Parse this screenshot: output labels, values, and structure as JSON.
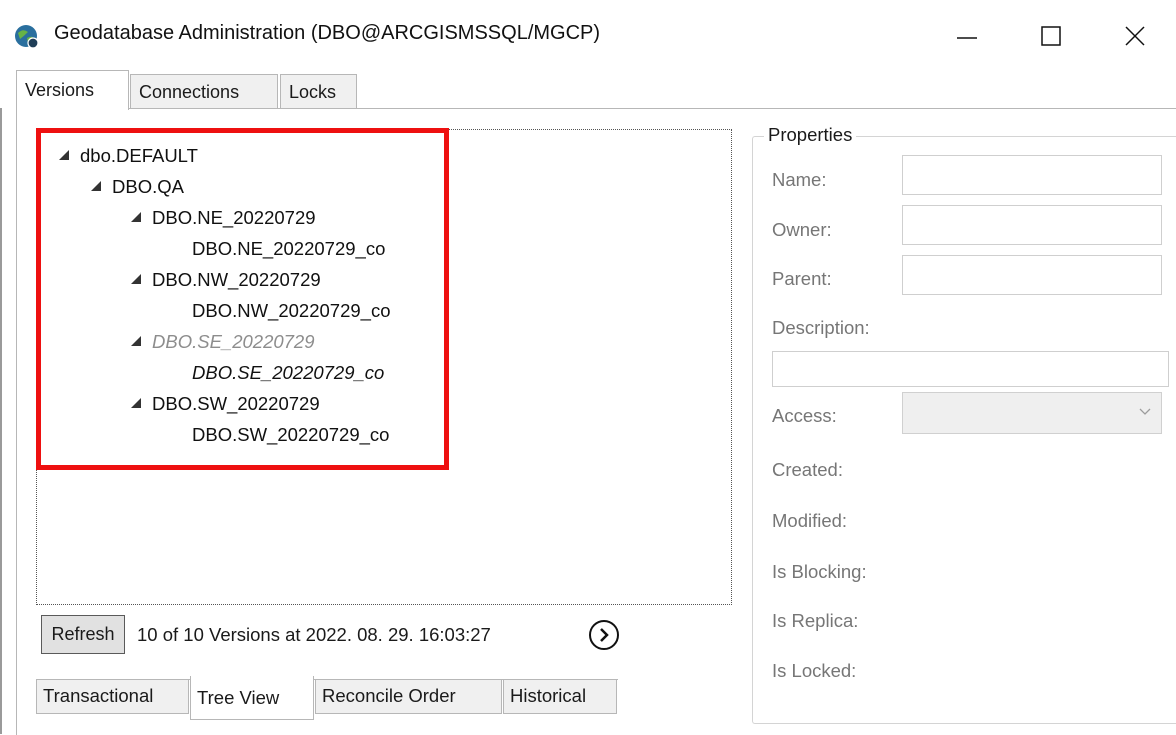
{
  "window": {
    "title": "Geodatabase Administration (DBO@ARCGISMSSQL/MGCP)",
    "icon": "globe-app-icon",
    "controls": [
      "minimize-icon",
      "maximize-icon",
      "close-icon"
    ]
  },
  "top_tabs": [
    {
      "label": "Versions",
      "active": true
    },
    {
      "label": "Connections",
      "active": false
    },
    {
      "label": "Locks",
      "active": false
    }
  ],
  "tree": {
    "nodes": [
      {
        "label": "dbo.DEFAULT",
        "expandable": true,
        "style": "normal"
      },
      {
        "label": "DBO.QA",
        "expandable": true,
        "style": "normal"
      },
      {
        "label": "DBO.NE_20220729",
        "expandable": true,
        "style": "normal"
      },
      {
        "label": "DBO.NE_20220729_co",
        "expandable": false,
        "style": "normal"
      },
      {
        "label": "DBO.NW_20220729",
        "expandable": true,
        "style": "normal"
      },
      {
        "label": "DBO.NW_20220729_co",
        "expandable": false,
        "style": "normal"
      },
      {
        "label": "DBO.SE_20220729",
        "expandable": true,
        "style": "dim-italic"
      },
      {
        "label": "DBO.SE_20220729_co",
        "expandable": false,
        "style": "italic"
      },
      {
        "label": "DBO.SW_20220729",
        "expandable": true,
        "style": "normal"
      },
      {
        "label": "DBO.SW_20220729_co",
        "expandable": false,
        "style": "normal"
      }
    ]
  },
  "footer": {
    "refresh_label": "Refresh",
    "status": "10 of 10 Versions at 2022. 08. 29. 16:03:27",
    "next_icon": "chevron-right-circle-icon"
  },
  "bottom_tabs": [
    {
      "label": "Transactional",
      "active": false
    },
    {
      "label": "Tree View",
      "active": true
    },
    {
      "label": "Reconcile Order",
      "active": false
    },
    {
      "label": "Historical",
      "active": false
    }
  ],
  "properties": {
    "title": "Properties",
    "name_label": "Name:",
    "owner_label": "Owner:",
    "parent_label": "Parent:",
    "description_label": "Description:",
    "access_label": "Access:",
    "created_label": "Created:",
    "modified_label": "Modified:",
    "blocking_label": "Is Blocking:",
    "replica_label": "Is Replica:",
    "locked_label": "Is Locked:"
  },
  "colors": {
    "highlight": "#ee1010",
    "dim_text": "#8d8d8d",
    "label_text": "#767676"
  }
}
